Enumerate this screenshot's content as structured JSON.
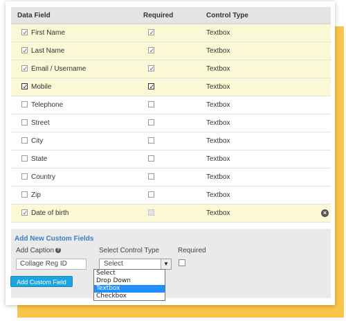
{
  "table": {
    "headers": {
      "field": "Data Field",
      "required": "Required",
      "control": "Control Type"
    },
    "rows": [
      {
        "label": "First Name",
        "checked": true,
        "required": true,
        "control": "Textbox"
      },
      {
        "label": "Last Name",
        "checked": true,
        "required": true,
        "control": "Textbox"
      },
      {
        "label": "Email / Username",
        "checked": true,
        "required": true,
        "control": "Textbox"
      },
      {
        "label": "Mobile",
        "checked": true,
        "required": true,
        "control": "Textbox"
      },
      {
        "label": "Telephone",
        "checked": false,
        "required": false,
        "control": "Textbox"
      },
      {
        "label": "Street",
        "checked": false,
        "required": false,
        "control": "Textbox"
      },
      {
        "label": "City",
        "checked": false,
        "required": false,
        "control": "Textbox"
      },
      {
        "label": "State",
        "checked": false,
        "required": false,
        "control": "Textbox"
      },
      {
        "label": "Country",
        "checked": false,
        "required": false,
        "control": "Textbox"
      },
      {
        "label": "Zip",
        "checked": false,
        "required": false,
        "control": "Textbox"
      },
      {
        "label": "Date of birth",
        "checked": true,
        "required": false,
        "control": "Textbox"
      }
    ]
  },
  "custom": {
    "title": "Add New Custom Fields",
    "caption_label": "Add Caption",
    "control_label": "Select Control Type",
    "required_label": "Required",
    "caption_value": "Collage Reg ID",
    "select_value": "Select",
    "options": [
      "Select",
      "Drop Down",
      "Textbox",
      "Checkbox"
    ],
    "highlighted_option": "Textbox",
    "button_label": "Add Custom Field"
  },
  "icons": {
    "help": "question-circle-icon",
    "remove": "remove-circle-icon",
    "arrow": "chevron-down-icon"
  },
  "colors": {
    "accent": "#1ca4de",
    "selected_row": "#fbf8d6",
    "frame": "#f8c44a",
    "link": "#3a7ec1"
  }
}
